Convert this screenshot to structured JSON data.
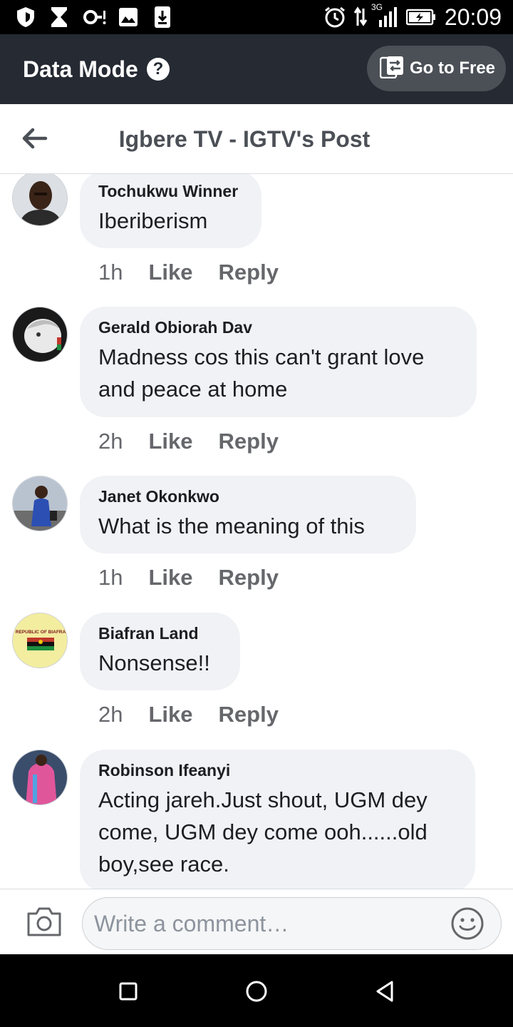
{
  "status_bar": {
    "time": "20:09",
    "network": "3G",
    "icons": [
      "shield-icon",
      "hourglass-icon",
      "vpn-key-icon",
      "image-icon",
      "download-icon",
      "alarm-icon",
      "signal-icon",
      "battery-charging-icon"
    ]
  },
  "data_mode": {
    "title": "Data Mode",
    "help": "?",
    "go_free_label": "Go to Free"
  },
  "header": {
    "title": "Igbere TV - IGTV's Post"
  },
  "comments": [
    {
      "name": "Tochukwu Winner",
      "text": "Iberiberism",
      "time": "1h",
      "like": "Like",
      "reply": "Reply"
    },
    {
      "name": "Gerald Obiorah Dav",
      "text": "Madness cos this can't grant love and peace at home",
      "time": "2h",
      "like": "Like",
      "reply": "Reply"
    },
    {
      "name": "Janet Okonkwo",
      "text": "What is the meaning of this",
      "time": "1h",
      "like": "Like",
      "reply": "Reply"
    },
    {
      "name": "Biafran Land",
      "text": "Nonsense!!",
      "time": "2h",
      "like": "Like",
      "reply": "Reply",
      "avatar_text": "REPUBLIC OF BIAFRA"
    },
    {
      "name": "Robinson Ifeanyi",
      "text": "Acting jareh.Just shout, UGM dey come, UGM dey come ooh......old boy,see race."
    }
  ],
  "composer": {
    "placeholder": "Write a comment…"
  },
  "colors": {
    "data_mode_bg": "#252a33",
    "bubble_bg": "#f0f2f5",
    "meta_text": "#65676b"
  }
}
